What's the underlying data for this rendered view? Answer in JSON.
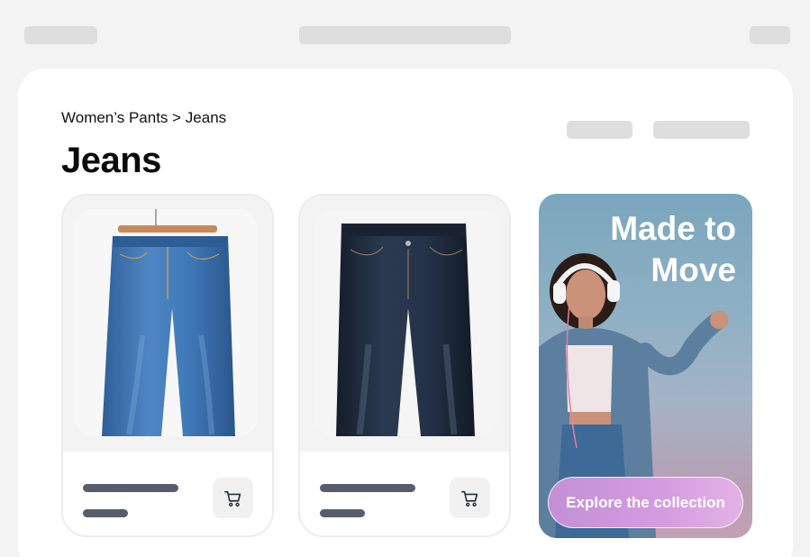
{
  "breadcrumb": "Women’s Pants > Jeans",
  "page_title": "Jeans",
  "promo": {
    "headline_line1": "Made to",
    "headline_line2": "Move",
    "cta_label": "Explore the collection"
  },
  "products": [
    {
      "image": "light-wash-jeans-on-hanger",
      "icon": "cart-icon"
    },
    {
      "image": "dark-wash-jeans",
      "icon": "cart-icon"
    }
  ],
  "colors": {
    "page_bg": "#f3f3f3",
    "panel_bg": "#ffffff",
    "placeholder": "#dedede",
    "text_line": "#565e6c",
    "cta_gradient_start": "#c48fd6",
    "cta_gradient_end": "#e3b2e6"
  }
}
